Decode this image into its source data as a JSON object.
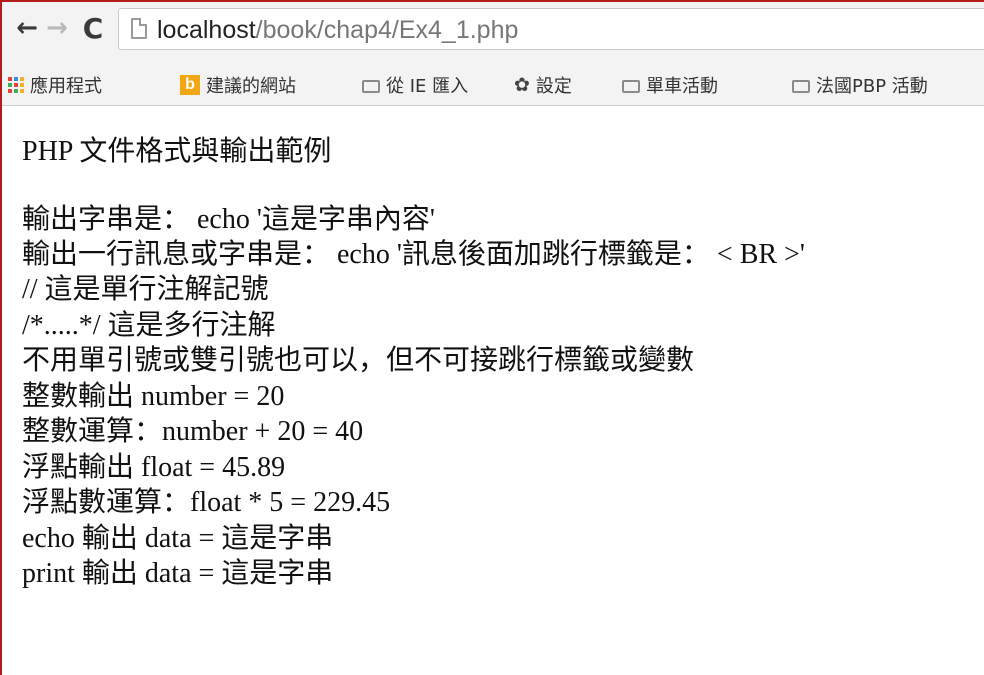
{
  "toolbar": {
    "back_glyph": "←",
    "forward_glyph": "→",
    "reload_glyph": "C",
    "url_host": "localhost",
    "url_path": "/book/chap4/Ex4_1.php"
  },
  "bookmarks": [
    {
      "label": "應用程式",
      "icon": "apps-icon"
    },
    {
      "label": "建議的網站",
      "icon": "bing-icon"
    },
    {
      "label": "從 IE 匯入",
      "icon": "folder-icon"
    },
    {
      "label": "設定",
      "icon": "gear-icon"
    },
    {
      "label": "單車活動",
      "icon": "folder-icon"
    },
    {
      "label": "法國PBP 活動",
      "icon": "folder-icon"
    }
  ],
  "content": {
    "title": "PHP 文件格式與輸出範例",
    "lines": [
      "輸出字串是： echo '這是字串內容'",
      "輸出一行訊息或字串是： echo '訊息後面加跳行標籤是： < BR >'",
      "// 這是單行注解記號",
      "/*.....*/ 這是多行注解",
      "不用單引號或雙引號也可以，但不可接跳行標籤或變數",
      "整數輸出 number = 20",
      "整數運算：number + 20 = 40",
      "浮點輸出 float = 45.89",
      "浮點數運算：float * 5 = 229.45",
      "echo 輸出 data = 這是字串",
      "print 輸出 data = 這是字串"
    ]
  }
}
